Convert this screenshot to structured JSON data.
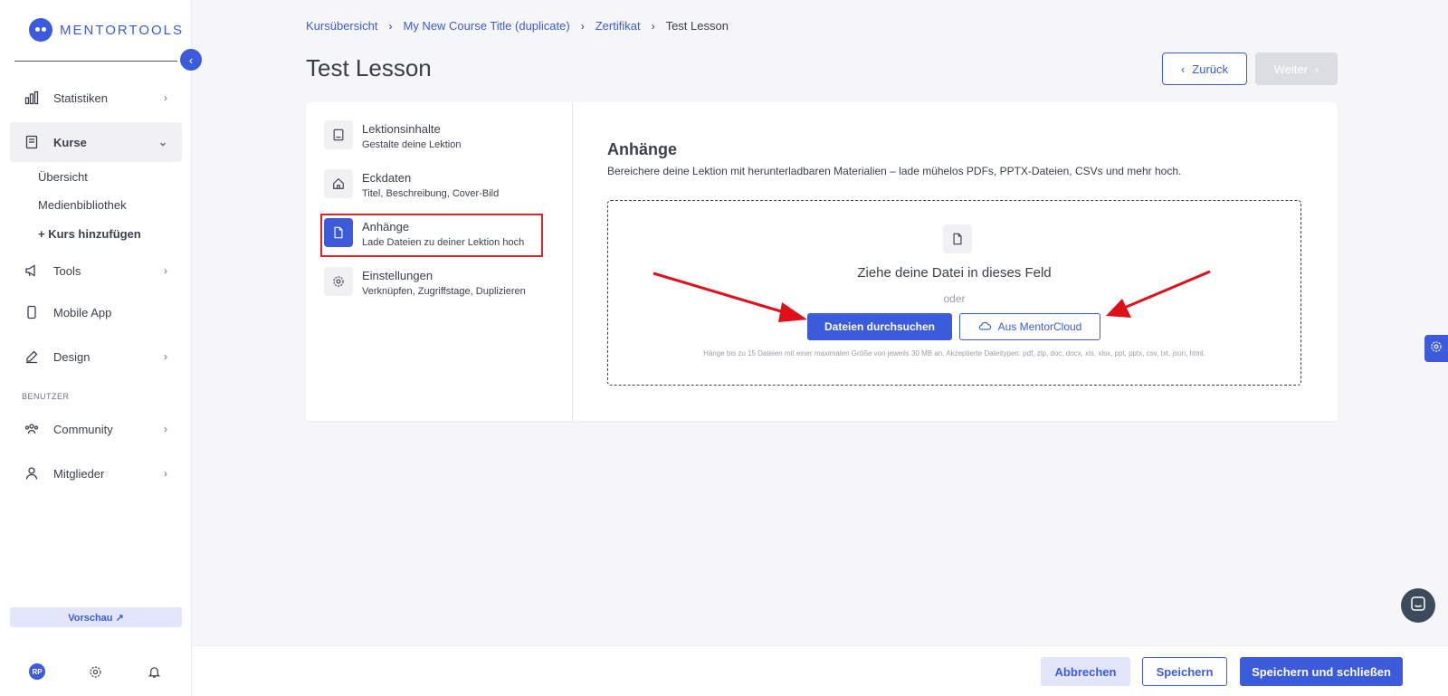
{
  "app": {
    "logo_text": "MENTORTOOLS"
  },
  "sidebar": {
    "items": [
      {
        "label": "Statistiken",
        "icon": "bar-chart-icon"
      },
      {
        "label": "Kurse",
        "icon": "book-icon"
      },
      {
        "label": "Tools",
        "icon": "megaphone-icon"
      },
      {
        "label": "Mobile App",
        "icon": "phone-icon"
      },
      {
        "label": "Design",
        "icon": "pencil-icon"
      },
      {
        "label": "Community",
        "icon": "people-icon"
      },
      {
        "label": "Mitglieder",
        "icon": "user-icon"
      }
    ],
    "sub_items": [
      "Übersicht",
      "Medienbibliothek",
      "+ Kurs hinzufügen"
    ],
    "section_label": "BENUTZER",
    "preview_label": "Vorschau ↗",
    "avatar_initials": "RP"
  },
  "breadcrumb": [
    "Kursübersicht",
    "My New Course Title (duplicate)",
    "Zertifikat",
    "Test Lesson"
  ],
  "page": {
    "title": "Test Lesson",
    "back_label": "Zurück",
    "next_label": "Weiter"
  },
  "steps": [
    {
      "title": "Lektionsinhalte",
      "subtitle": "Gestalte deine Lektion"
    },
    {
      "title": "Eckdaten",
      "subtitle": "Titel, Beschreibung, Cover-Bild"
    },
    {
      "title": "Anhänge",
      "subtitle": "Lade Dateien zu deiner Lektion hoch"
    },
    {
      "title": "Einstellungen",
      "subtitle": "Verknüpfen, Zugriffstage, Duplizieren"
    }
  ],
  "attachments": {
    "title": "Anhänge",
    "description": "Bereichere deine Lektion mit herunterladbaren Materialien – lade mühelos PDFs, PPTX-Dateien, CSVs und mehr hoch.",
    "drop_title": "Ziehe deine Datei in dieses Feld",
    "or": "oder",
    "browse_label": "Dateien durchsuchen",
    "cloud_label": "Aus MentorCloud",
    "note": "Hänge bis zu 15 Dateien mit einer maximalen Größe von jeweils 30 MB an. Akzeptierte Dateitypen: pdf, zip, doc, docx, xls, xlsx, ppt, pptx, csv, txt, json, html."
  },
  "footer": {
    "cancel_label": "Abbrechen",
    "save_label": "Speichern",
    "save_close_label": "Speichern und schließen"
  },
  "colors": {
    "accent": "#3b5bdb",
    "highlight": "#d9262d"
  }
}
